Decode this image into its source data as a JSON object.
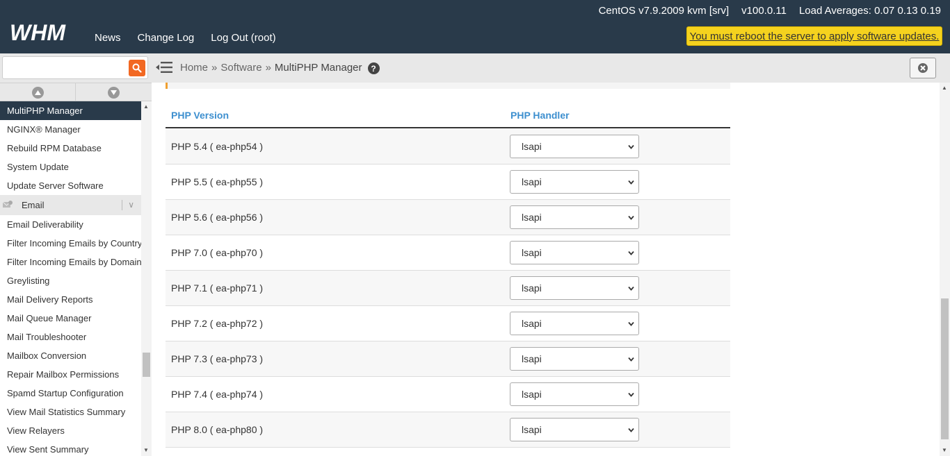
{
  "header": {
    "logo_text": "WHM",
    "nav": [
      "News",
      "Change Log",
      "Log Out (root)"
    ],
    "os": "CentOS v7.9.2009 kvm [srv]",
    "version": "v100.0.11",
    "load": "Load Averages: 0.07 0.13 0.19",
    "reboot_notice": "You must reboot the server to apply software updates."
  },
  "search": {
    "placeholder": ""
  },
  "breadcrumb": {
    "home": "Home",
    "sep": "»",
    "section": "Software",
    "current": "MultiPHP Manager"
  },
  "sidebar": {
    "items_top": [
      "MultiPHP Manager",
      "NGINX® Manager",
      "Rebuild RPM Database",
      "System Update",
      "Update Server Software"
    ],
    "category": "Email",
    "items_email": [
      "Email Deliverability",
      "Filter Incoming Emails by Country",
      "Filter Incoming Emails by Domain",
      "Greylisting",
      "Mail Delivery Reports",
      "Mail Queue Manager",
      "Mail Troubleshooter",
      "Mailbox Conversion",
      "Repair Mailbox Permissions",
      "Spamd Startup Configuration",
      "View Mail Statistics Summary",
      "View Relayers",
      "View Sent Summary"
    ]
  },
  "table": {
    "col_version": "PHP Version",
    "col_handler": "PHP Handler",
    "rows": [
      {
        "version": "PHP 5.4 ( ea-php54 )",
        "handler": "lsapi"
      },
      {
        "version": "PHP 5.5 ( ea-php55 )",
        "handler": "lsapi"
      },
      {
        "version": "PHP 5.6 ( ea-php56 )",
        "handler": "lsapi"
      },
      {
        "version": "PHP 7.0 ( ea-php70 )",
        "handler": "lsapi"
      },
      {
        "version": "PHP 7.1 ( ea-php71 )",
        "handler": "lsapi"
      },
      {
        "version": "PHP 7.2 ( ea-php72 )",
        "handler": "lsapi"
      },
      {
        "version": "PHP 7.3 ( ea-php73 )",
        "handler": "lsapi"
      },
      {
        "version": "PHP 7.4 ( ea-php74 )",
        "handler": "lsapi"
      },
      {
        "version": "PHP 8.0 ( ea-php80 )",
        "handler": "lsapi"
      }
    ]
  },
  "colors": {
    "header_bg": "#293a4a",
    "accent_orange": "#f26822",
    "link_blue": "#3d8fcf",
    "notice_yellow": "#f5d21e"
  }
}
